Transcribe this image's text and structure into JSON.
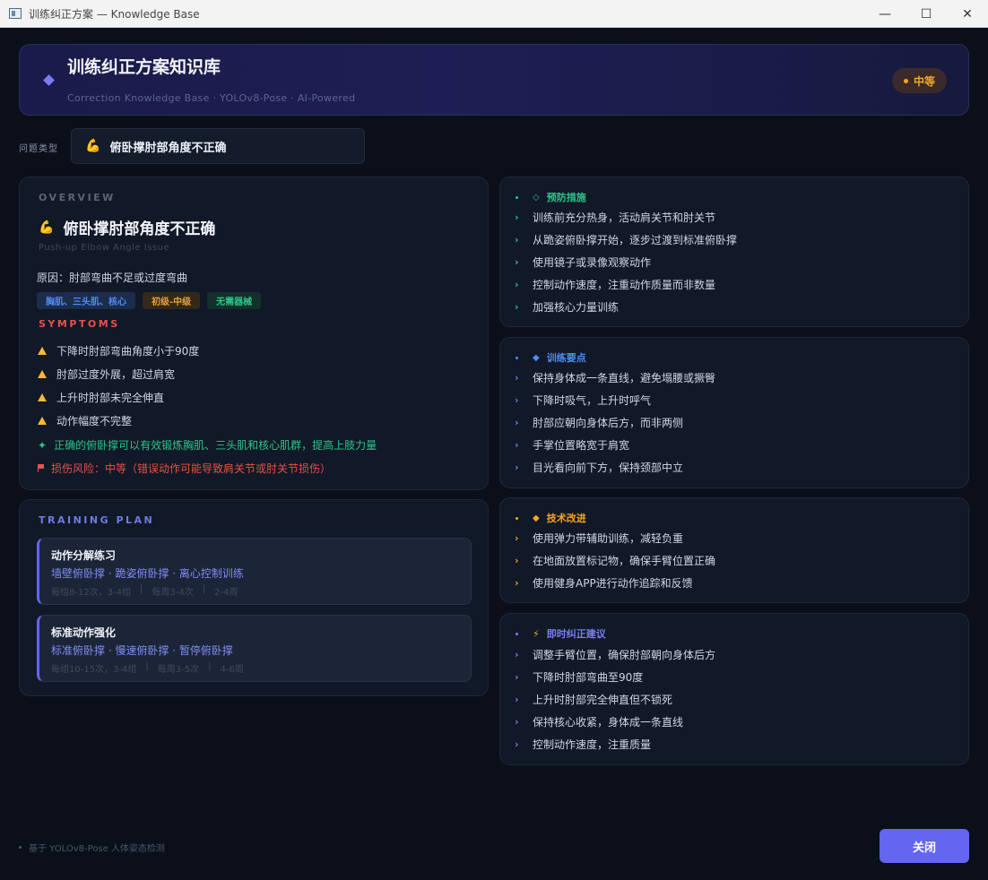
{
  "window": {
    "title": "训练纠正方案 — Knowledge Base",
    "minimize": "—",
    "maximize": "☐",
    "close": "✕"
  },
  "header": {
    "title": "训练纠正方案知识库",
    "subtitle": "Correction Knowledge Base · YOLOv8-Pose · AI-Powered",
    "badge": "中等"
  },
  "problem": {
    "label": "问题类型",
    "icon": "💪",
    "value": "俯卧撑肘部角度不正确"
  },
  "overview": {
    "label": "OVERVIEW",
    "icon": "💪",
    "title": "俯卧撑肘部角度不正确",
    "subtitle_en": "Push-up Elbow Angle Issue",
    "cause": "原因：肘部弯曲不足或过度弯曲",
    "tags": [
      "胸肌、三头肌、核心",
      "初级-中级",
      "无需器械"
    ],
    "symptoms_label": "SYMPTOMS",
    "symptoms": [
      "下降时肘部弯曲角度小于90度",
      "肘部过度外展，超过肩宽",
      "上升时肘部未完全伸直",
      "动作幅度不完整"
    ],
    "benefit_icon": "✦",
    "benefit": "正确的俯卧撑可以有效锻炼胸肌、三头肌和核心肌群，提高上肢力量",
    "risk": "损伤风险：中等（错误动作可能导致肩关节或肘关节损伤）"
  },
  "plan": {
    "label": "TRAINING PLAN",
    "items": [
      {
        "name": "动作分解练习",
        "exercises": "墙壁俯卧撑 · 跪姿俯卧撑 · 离心控制训练",
        "reps": "每组8-12次，3-4组",
        "freq": "每周3-4次",
        "duration": "2-4周",
        "sep": "|"
      },
      {
        "name": "标准动作强化",
        "exercises": "标准俯卧撑 · 慢速俯卧撑 · 暂停俯卧撑",
        "reps": "每组10-15次，3-4组",
        "freq": "每周3-5次",
        "duration": "4-6周",
        "sep": "|"
      }
    ]
  },
  "prevention": {
    "icon": "◇",
    "title": "预防措施",
    "color": "#2ec48b",
    "items": [
      "训练前充分热身，活动肩关节和肘关节",
      "从跪姿俯卧撑开始，逐步过渡到标准俯卧撑",
      "使用镜子或录像观察动作",
      "控制动作速度，注重动作质量而非数量",
      "加强核心力量训练"
    ]
  },
  "keypoints": {
    "icon": "◆",
    "title": "训练要点",
    "color": "#4f8df0",
    "items": [
      "保持身体成一条直线，避免塌腰或撅臀",
      "下降时吸气，上升时呼气",
      "肘部应朝向身体后方，而非两侧",
      "手掌位置略宽于肩宽",
      "目光看向前下方，保持颈部中立"
    ]
  },
  "technique": {
    "icon": "◆",
    "title": "技术改进",
    "color": "#f5a623",
    "items": [
      "使用弹力带辅助训练，减轻负重",
      "在地面放置标记物，确保手臂位置正确",
      "使用健身APP进行动作追踪和反馈"
    ]
  },
  "instant": {
    "icon": "⚡",
    "title": "即时纠正建议",
    "color": "#7b7cf0",
    "items": [
      "调整手臂位置，确保肘部朝向身体后方",
      "下降时肘部弯曲至90度",
      "上升时肘部完全伸直但不锁死",
      "保持核心收紧，身体成一条直线",
      "控制动作速度，注重质量"
    ]
  },
  "footer": {
    "note": "基于 YOLOv8-Pose 人体姿态检测",
    "close": "关闭"
  },
  "colors": {
    "accent": "#6366f1",
    "danger": "#e8514a",
    "success": "#2ec48b",
    "warning": "#f5b83a"
  }
}
